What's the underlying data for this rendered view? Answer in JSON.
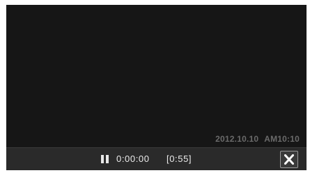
{
  "overlay": {
    "date": "2012.10.10",
    "time": "AM10:10"
  },
  "playback": {
    "state_icon": "pause-icon",
    "elapsed": "0:00:00",
    "duration": "[0:55]"
  },
  "controls": {
    "close_icon": "close-icon"
  },
  "colors": {
    "screen_bg": "#151515",
    "bar_bg": "#2a2a2a",
    "text": "#ececec",
    "timestamp_text": "#6a6a6a"
  }
}
